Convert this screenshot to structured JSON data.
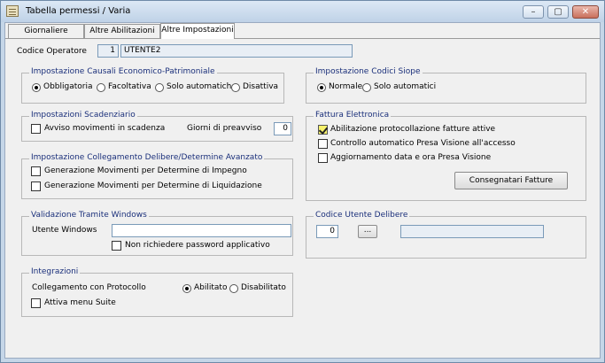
{
  "window": {
    "title": "Tabella permessi / Varia",
    "min_glyph": "–",
    "max_glyph": "▢",
    "close_glyph": "✕"
  },
  "tabs": [
    "Giornaliere",
    "Altre Abilitazioni",
    "Altre Impostazioni"
  ],
  "operator": {
    "label": "Codice Operatore",
    "code": "1",
    "name": "UTENTE2"
  },
  "causali": {
    "title": "Impostazione Causali Economico-Patrimoniale",
    "options": [
      "Obbligatoria",
      "Facoltativa",
      "Solo automatiche",
      "Disattiva"
    ],
    "selected": "Obbligatoria"
  },
  "siope": {
    "title": "Impostazione Codici Siope",
    "options": [
      "Normale",
      "Solo automatici"
    ],
    "selected": "Normale"
  },
  "scadenziario": {
    "title": "Impostazioni Scadenziario",
    "checkbox_label": "Avviso movimenti in scadenza",
    "checked": false,
    "days_label": "Giorni di preavviso",
    "days_value": "0"
  },
  "fattura": {
    "title": "Fattura Elettronica",
    "items": [
      {
        "label": "Abilitazione protocollazione fatture attive",
        "checked": true
      },
      {
        "label": "Controllo automatico Presa Visione all'accesso",
        "checked": false
      },
      {
        "label": "Aggiornamento data e ora Presa Visione",
        "checked": false
      }
    ],
    "button_label": "Consegnatari Fatture"
  },
  "delibere": {
    "title": "Impostazione Collegamento Delibere/Determine Avanzato",
    "items": [
      {
        "label": "Generazione Movimenti per Determine di Impegno",
        "checked": false
      },
      {
        "label": "Generazione Movimenti per Determine di Liquidazione",
        "checked": false
      }
    ]
  },
  "windows": {
    "title": "Validazione Tramite Windows",
    "user_label": "Utente Windows",
    "user_value": "",
    "checkbox_label": "Non richiedere password applicativo",
    "checked": false
  },
  "codice_delibere": {
    "title": "Codice Utente Delibere",
    "value": "0",
    "browse_label": "...",
    "description": ""
  },
  "integrazioni": {
    "title": "Integrazioni",
    "protocol_label": "Collegamento con Protocollo",
    "options": [
      "Abilitato",
      "Disabilitato"
    ],
    "selected": "Abilitato",
    "checkbox_label": "Attiva menu Suite",
    "checked": false
  }
}
